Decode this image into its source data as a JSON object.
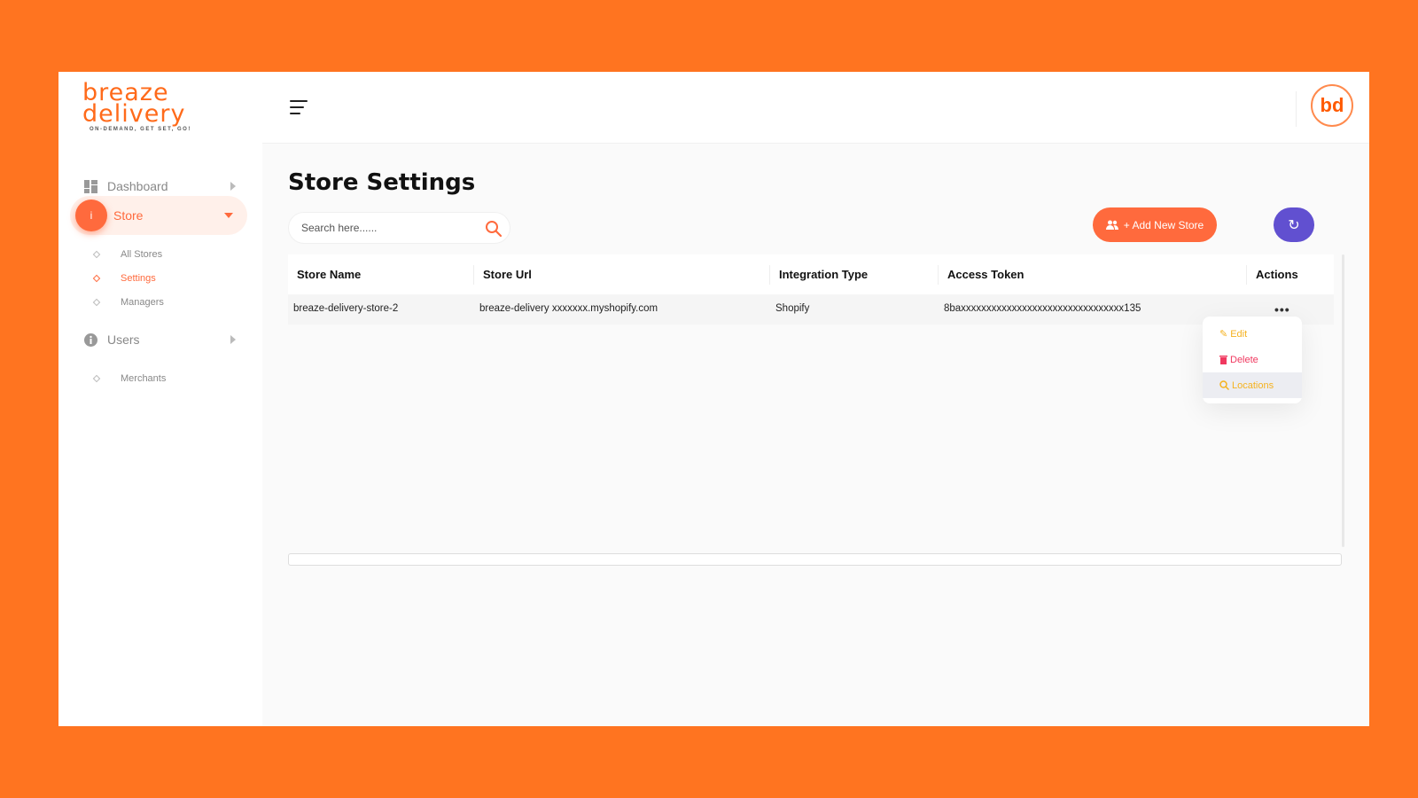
{
  "brand": {
    "name_line1": "breaze",
    "name_line2": "delivery",
    "tagline": "ON-DEMAND, GET SET, GO!",
    "avatar_initials": "bd",
    "accent": "#ff6a3d",
    "frame": "#ff7420"
  },
  "sidebar": {
    "items": [
      {
        "label": "Dashboard",
        "icon": "grid-icon"
      },
      {
        "label": "Store",
        "icon": "info-icon",
        "active": true,
        "children": [
          {
            "label": "All Stores"
          },
          {
            "label": "Settings",
            "active": true
          },
          {
            "label": "Managers"
          }
        ]
      },
      {
        "label": "Users",
        "icon": "info-icon",
        "children": [
          {
            "label": "Merchants"
          }
        ]
      }
    ]
  },
  "page": {
    "title": "Store Settings"
  },
  "search": {
    "placeholder": "Search here......",
    "value": ""
  },
  "toolbar": {
    "add_label": "+ Add New Store",
    "refresh_icon": "refresh-icon",
    "refresh_color": "#6150d0"
  },
  "table": {
    "columns": [
      "Store Name",
      "Store Url",
      "Integration Type",
      "Access Token",
      "Actions"
    ],
    "rows": [
      {
        "store_name": "breaze-delivery-store-2",
        "store_url": "breaze-delivery xxxxxxx.myshopify.com",
        "integration_type": "Shopify",
        "access_token": "8baxxxxxxxxxxxxxxxxxxxxxxxxxxxxxxxx135"
      }
    ]
  },
  "actions_menu": {
    "items": [
      {
        "label": "Edit",
        "icon": "edit-icon"
      },
      {
        "label": "Delete",
        "icon": "trash-icon"
      },
      {
        "label": "Locations",
        "icon": "search-location-icon",
        "hovered": true
      }
    ]
  }
}
